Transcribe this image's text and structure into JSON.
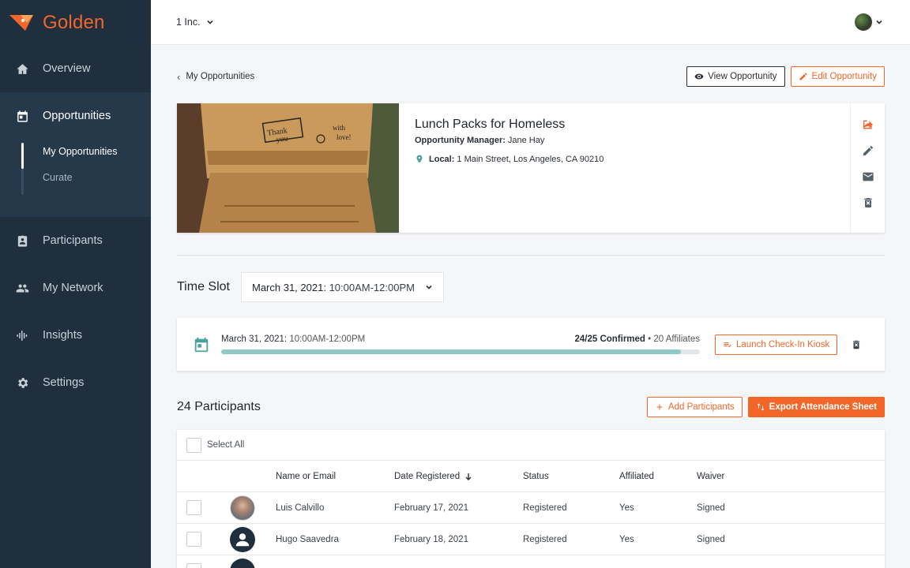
{
  "app": {
    "name": "Golden"
  },
  "sidebar": {
    "items": [
      {
        "label": "Overview",
        "icon": "home-icon"
      },
      {
        "label": "Opportunities",
        "icon": "calendar-icon",
        "active": true,
        "sub": [
          {
            "label": "My Opportunities",
            "active": true
          },
          {
            "label": "Curate"
          }
        ]
      },
      {
        "label": "Participants",
        "icon": "badge-icon"
      },
      {
        "label": "My Network",
        "icon": "people-icon"
      },
      {
        "label": "Insights",
        "icon": "insights-icon"
      },
      {
        "label": "Settings",
        "icon": "gear-icon"
      }
    ]
  },
  "topbar": {
    "org": "1 Inc."
  },
  "breadcrumb": {
    "label": "My Opportunities"
  },
  "actions": {
    "view": "View Opportunity",
    "edit": "Edit Opportunity"
  },
  "opportunity": {
    "title": "Lunch Packs for Homeless",
    "manager_label": "Opportunity Manager:",
    "manager": "Jane Hay",
    "location_label": "Local:",
    "location": "1 Main Street, Los Angeles, CA 90210"
  },
  "timeslot": {
    "label": "Time Slot",
    "date": "March 31, 2021:",
    "time": "10:00AM-12:00PM"
  },
  "slot": {
    "date": "March 31, 2021:",
    "time": "10:00AM-12:00PM",
    "confirmed": "24/25 Confirmed",
    "affiliates": "• 20 Affiliates",
    "progress": 0.96,
    "kiosk": "Launch Check-In Kiosk"
  },
  "participants": {
    "title": "24 Participants",
    "add": "Add Participants",
    "export": "Export Attendance Sheet",
    "select_all": "Select All",
    "columns": {
      "name": "Name or Email",
      "date": "Date Registered",
      "status": "Status",
      "affiliated": "Affiliated",
      "waiver": "Waiver"
    },
    "rows": [
      {
        "name": "Luis Calvillo",
        "date": "February 17, 2021",
        "status": "Registered",
        "affiliated": "Yes",
        "waiver": "Signed"
      },
      {
        "name": "Hugo Saavedra",
        "date": "February 18, 2021",
        "status": "Registered",
        "affiliated": "Yes",
        "waiver": "Signed"
      }
    ]
  },
  "colors": {
    "accent": "#f2662a",
    "teal": "#4aa3a0",
    "sidebar": "#1f2f3d"
  }
}
